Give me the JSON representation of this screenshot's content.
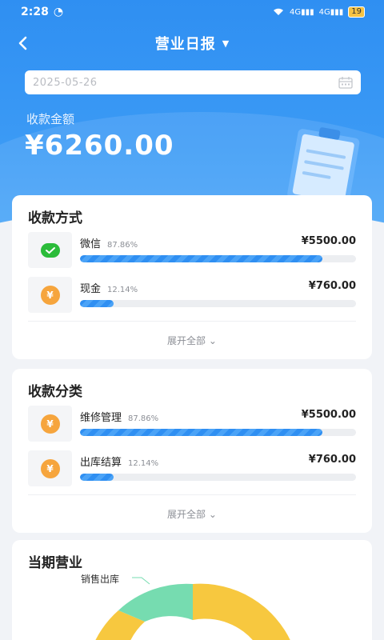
{
  "status_bar": {
    "time": "2:28",
    "battery": "19",
    "network_1": "4G",
    "network_2": "4G"
  },
  "nav": {
    "title": "营业日报"
  },
  "date_field": {
    "value": "2025-05-26"
  },
  "summary": {
    "label": "收款金额",
    "amount": "¥6260.00"
  },
  "payment_methods": {
    "title": "收款方式",
    "items": [
      {
        "name": "微信",
        "percent": "87.86%",
        "amount": "¥5500.00",
        "progress": 0.8786,
        "icon": "wechat-icon"
      },
      {
        "name": "现金",
        "percent": "12.14%",
        "amount": "¥760.00",
        "progress": 0.1214,
        "icon": "coin-icon"
      }
    ],
    "expand_label": "展开全部"
  },
  "payment_categories": {
    "title": "收款分类",
    "items": [
      {
        "name": "维修管理",
        "percent": "87.86%",
        "amount": "¥5500.00",
        "progress": 0.8786,
        "icon": "coin-icon"
      },
      {
        "name": "出库结算",
        "percent": "12.14%",
        "amount": "¥760.00",
        "progress": 0.1214,
        "icon": "coin-icon"
      }
    ],
    "expand_label": "展开全部"
  },
  "current_period": {
    "title": "当期营业",
    "chart_label": "销售出库"
  },
  "colors": {
    "primary": "#2f8ff2",
    "donut_yellow": "#f7c83f",
    "donut_green": "#76dcb0",
    "coin": "#f6a53d",
    "wechat": "#2bbc3a"
  }
}
